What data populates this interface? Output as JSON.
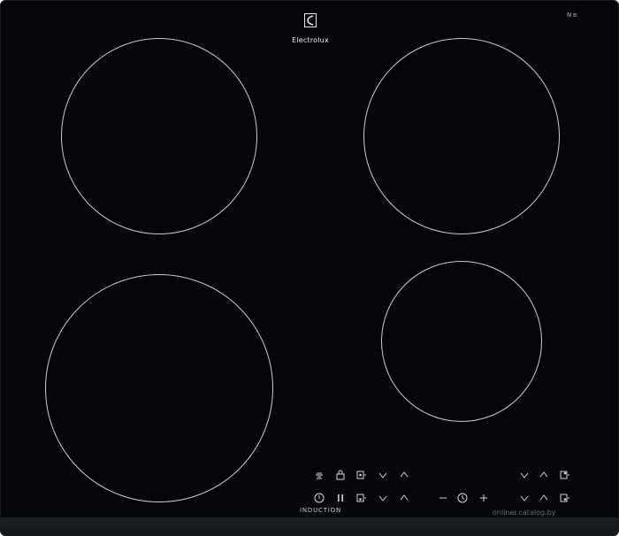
{
  "brand": {
    "name": "Electrolux",
    "logo_icon": "electrolux-logo-icon"
  },
  "corner_mark": "N≡",
  "panel": {
    "label": "INDUCTION"
  },
  "watermark": "onliner.catalog.by",
  "colors": {
    "glass": "#04060b",
    "zone_outline": "#c9ccd2",
    "text": "#e6e8ec"
  },
  "cooking_zones": [
    "front-left",
    "rear-left",
    "rear-right",
    "front-right"
  ],
  "controls_top_row": [
    "timer-icon",
    "lock-icon",
    "zone-select-icon",
    "chevron-down-icon",
    "chevron-up-icon",
    "chevron-down-icon",
    "chevron-up-icon",
    "zone-select-icon"
  ],
  "controls_bottom_row": [
    "power-icon",
    "pause-icon",
    "zone-select-icon",
    "chevron-down-icon",
    "chevron-up-icon",
    "minus-icon",
    "clock-icon",
    "plus-icon",
    "chevron-down-icon",
    "chevron-up-icon",
    "zone-select-icon"
  ],
  "controls": {
    "minus": "−",
    "plus": "+"
  }
}
